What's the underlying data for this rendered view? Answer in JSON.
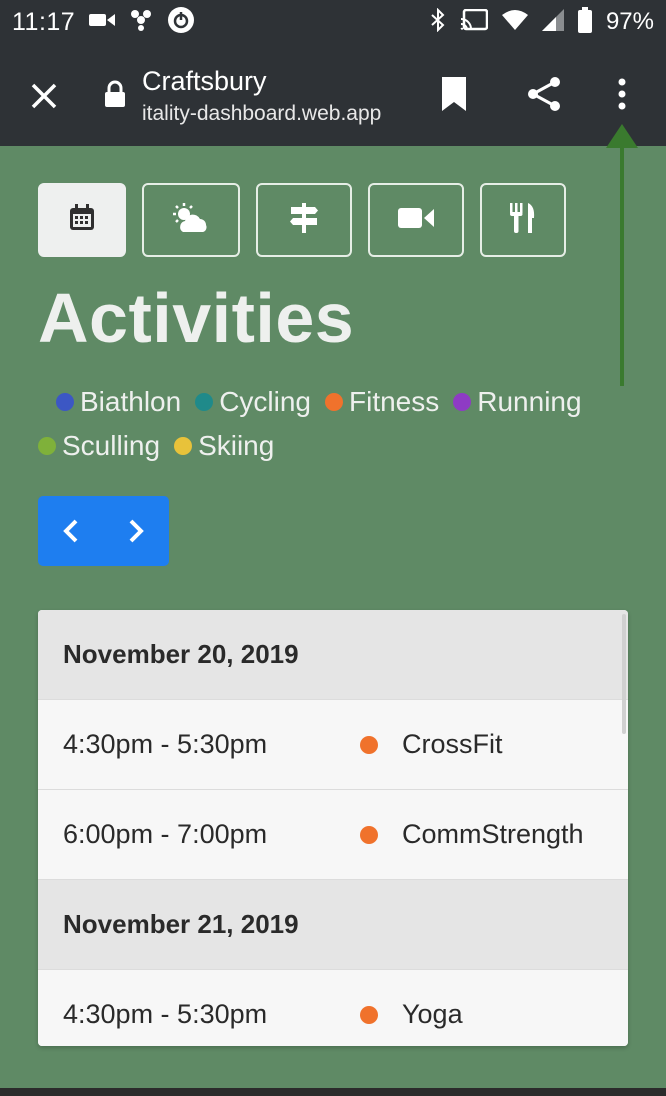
{
  "status": {
    "time": "11:17",
    "battery": "97%"
  },
  "browser": {
    "title": "Craftsbury",
    "url": "itality-dashboard.web.app"
  },
  "tabs": [
    {
      "icon": "calendar-icon",
      "active": true
    },
    {
      "icon": "weather-icon",
      "active": false
    },
    {
      "icon": "signpost-icon",
      "active": false
    },
    {
      "icon": "video-icon",
      "active": false
    },
    {
      "icon": "utensils-icon",
      "active": false
    }
  ],
  "page": {
    "title": "Activities"
  },
  "legend": [
    {
      "label": "Biathlon",
      "color": "#3c57c4"
    },
    {
      "label": "Cycling",
      "color": "#1f8a8a"
    },
    {
      "label": "Fitness",
      "color": "#f0722c"
    },
    {
      "label": "Running",
      "color": "#8e3bc4"
    },
    {
      "label": "Sculling",
      "color": "#7fb13a"
    },
    {
      "label": "Skiing",
      "color": "#e8c23a"
    }
  ],
  "schedule": [
    {
      "type": "date",
      "label": "November 20, 2019"
    },
    {
      "type": "event",
      "time": "4:30pm - 5:30pm",
      "name": "CrossFit",
      "color": "#f0722c"
    },
    {
      "type": "event",
      "time": "6:00pm - 7:00pm",
      "name": "CommStrength",
      "color": "#f0722c"
    },
    {
      "type": "date",
      "label": "November 21, 2019"
    },
    {
      "type": "event",
      "time": "4:30pm - 5:30pm",
      "name": "Yoga",
      "color": "#f0722c"
    }
  ]
}
